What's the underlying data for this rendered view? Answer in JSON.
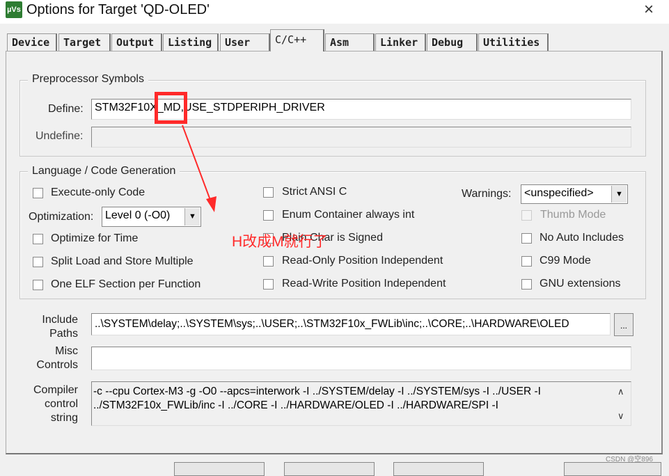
{
  "window": {
    "title": "Options for Target 'QD-OLED'",
    "logo": "µVs",
    "close_icon": "×"
  },
  "tabs": [
    {
      "label": "Device"
    },
    {
      "label": "Target"
    },
    {
      "label": "Output"
    },
    {
      "label": "Listing"
    },
    {
      "label": "User"
    },
    {
      "label": "C/C++",
      "selected": true
    },
    {
      "label": "Asm"
    },
    {
      "label": "Linker"
    },
    {
      "label": "Debug"
    },
    {
      "label": "Utilities"
    }
  ],
  "preprocessor": {
    "title": "Preprocessor Symbols",
    "define_label": "Define:",
    "define_value": "STM32F10X_MD,USE_STDPERIPH_DRIVER",
    "undefine_label": "Undefine:",
    "undefine_value": ""
  },
  "language": {
    "title": "Language / Code Generation",
    "execute_only": "Execute-only Code",
    "optimization_label": "Optimization:",
    "optimization_value": "Level 0 (-O0)",
    "optimize_time": "Optimize for Time",
    "split_load": "Split Load and Store Multiple",
    "one_elf": "One ELF Section per Function",
    "strict_ansi": "Strict ANSI C",
    "enum_container": "Enum Container always int",
    "plain_char": "Plain Char is Signed",
    "ro_pi": "Read-Only Position Independent",
    "rw_pi": "Read-Write Position Independent",
    "warnings_label": "Warnings:",
    "warnings_value": "<unspecified>",
    "thumb_mode": "Thumb Mode",
    "no_auto_includes": "No Auto Includes",
    "c99": "C99 Mode",
    "gnu_ext": "GNU extensions"
  },
  "include": {
    "label1": "Include",
    "label2": "Paths",
    "value": "..\\SYSTEM\\delay;..\\SYSTEM\\sys;..\\USER;..\\STM32F10x_FWLib\\inc;..\\CORE;..\\HARDWARE\\OLED",
    "browse": "..."
  },
  "misc": {
    "label1": "Misc",
    "label2": "Controls",
    "value": ""
  },
  "compiler": {
    "label1": "Compiler",
    "label2": "control",
    "label3": "string",
    "line1": "-c --cpu Cortex-M3 -g -O0 --apcs=interwork -I ../SYSTEM/delay -I ../SYSTEM/sys -I ../USER -I",
    "line2": "../STM32F10x_FWLib/inc -I ../CORE -I ../HARDWARE/OLED -I ../HARDWARE/SPI -I"
  },
  "annotation": {
    "text": "H改成M就行了",
    "color": "#ff2a2a"
  },
  "watermark": "CSDN @空896"
}
